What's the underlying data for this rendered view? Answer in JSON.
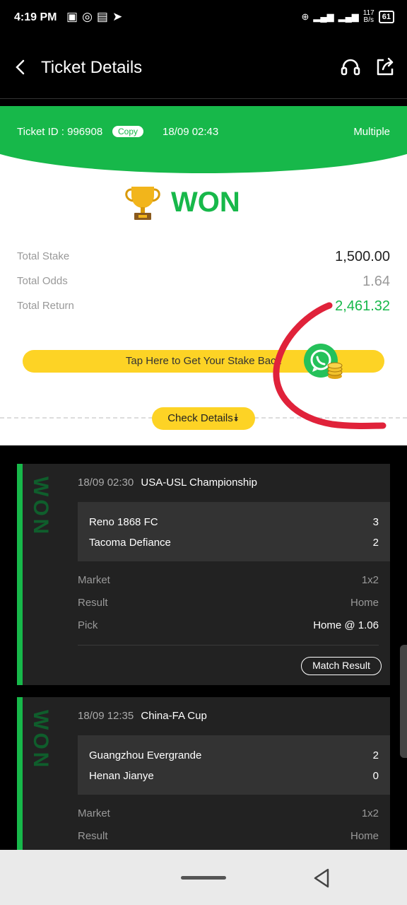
{
  "status_bar": {
    "time": "4:19 PM",
    "speed": "117",
    "speed_unit": "B/s",
    "battery": "61"
  },
  "header": {
    "title": "Ticket Details"
  },
  "ticket": {
    "id_label": "Ticket ID : 996908",
    "copy_label": "Copy",
    "date": "18/09 02:43",
    "type": "Multiple",
    "status": "WON",
    "summary": {
      "stake_label": "Total Stake",
      "stake_value": "1,500.00",
      "odds_label": "Total Odds",
      "odds_value": "1.64",
      "return_label": "Total Return",
      "return_value": "2,461.32"
    },
    "stake_back_label": "Tap Here to Get Your Stake Back",
    "check_details_label": "Check Details"
  },
  "matches": [
    {
      "status": "WON",
      "datetime": "18/09 02:30",
      "league": "USA-USL Championship",
      "home_team": "Reno 1868 FC",
      "home_score": "3",
      "away_team": "Tacoma Defiance",
      "away_score": "2",
      "market_label": "Market",
      "market_value": "1x2",
      "result_label": "Result",
      "result_value": "Home",
      "pick_label": "Pick",
      "pick_value": "Home @ 1.06",
      "button_label": "Match Result"
    },
    {
      "status": "WON",
      "datetime": "18/09 12:35",
      "league": "China-FA Cup",
      "home_team": "Guangzhou Evergrande",
      "home_score": "2",
      "away_team": "Henan Jianye",
      "away_score": "0",
      "market_label": "Market",
      "market_value": "1x2",
      "result_label": "Result",
      "result_value": "Home"
    }
  ],
  "colors": {
    "brand_green": "#17b84a",
    "button_yellow": "#fdd325",
    "annotation_red": "#e0223a"
  }
}
